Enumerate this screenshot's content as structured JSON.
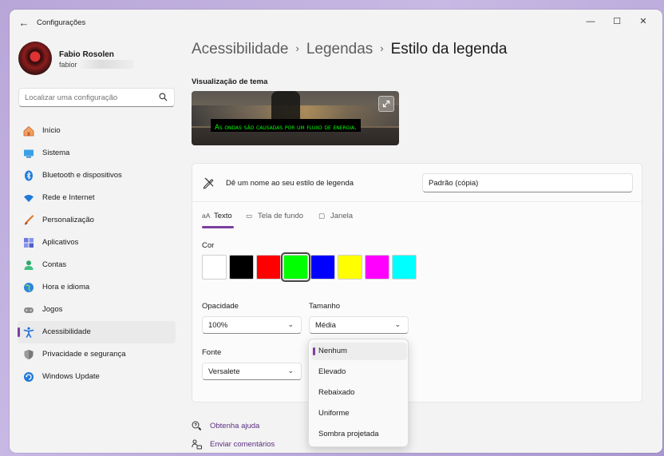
{
  "window": {
    "title": "Configurações",
    "controls": {
      "minimize": "—",
      "maximize": "☐",
      "close": "✕"
    }
  },
  "profile": {
    "name": "Fabio Rosolen",
    "email_visible": "fabior"
  },
  "search": {
    "placeholder": "Localizar uma configuração"
  },
  "sidebar": {
    "items": [
      {
        "label": "Início",
        "icon": "home-icon",
        "color": "#e07a2e"
      },
      {
        "label": "Sistema",
        "icon": "system-icon",
        "color": "#1f8fd8"
      },
      {
        "label": "Bluetooth e dispositivos",
        "icon": "bluetooth-icon",
        "color": "#1f7ad8"
      },
      {
        "label": "Rede e Internet",
        "icon": "wifi-icon",
        "color": "#1f7ad8"
      },
      {
        "label": "Personalização",
        "icon": "brush-icon",
        "color": "#e0702e"
      },
      {
        "label": "Aplicativos",
        "icon": "apps-icon",
        "color": "#5b6bd8"
      },
      {
        "label": "Contas",
        "icon": "account-icon",
        "color": "#2aa86a"
      },
      {
        "label": "Hora e idioma",
        "icon": "globe-clock-icon",
        "color": "#1f7ad8"
      },
      {
        "label": "Jogos",
        "icon": "gamepad-icon",
        "color": "#777777"
      },
      {
        "label": "Acessibilidade",
        "icon": "accessibility-icon",
        "color": "#1f6fd8"
      },
      {
        "label": "Privacidade e segurança",
        "icon": "shield-icon",
        "color": "#6b6b6b"
      },
      {
        "label": "Windows Update",
        "icon": "update-icon",
        "color": "#1f7ad8"
      }
    ],
    "active_index": 9
  },
  "breadcrumb": {
    "items": [
      "Acessibilidade",
      "Legendas"
    ],
    "current": "Estilo da legenda",
    "separator": "›"
  },
  "preview": {
    "title": "Visualização de tema",
    "caption": "As ondas são causadas por um fluxo de energia.",
    "caption_color": "#00ff00"
  },
  "style_name": {
    "label": "Dê um nome ao seu estilo de legenda",
    "value": "Padrão (cópia)"
  },
  "tabs": [
    {
      "label": "Texto",
      "icon": "aA",
      "active": true
    },
    {
      "label": "Tela de fundo",
      "icon": "▭",
      "active": false
    },
    {
      "label": "Janela",
      "icon": "▢",
      "active": false
    }
  ],
  "color": {
    "label": "Cor",
    "swatches": [
      "#ffffff",
      "#000000",
      "#ff0000",
      "#00ff00",
      "#0000ff",
      "#ffff00",
      "#ff00ff",
      "#00ffff"
    ],
    "selected_index": 3
  },
  "opacity": {
    "label": "Opacidade",
    "value": "100%"
  },
  "size": {
    "label": "Tamanho",
    "value": "Média"
  },
  "font": {
    "label": "Fonte",
    "value": "Versalete"
  },
  "effects_dropdown": {
    "options": [
      "Nenhum",
      "Elevado",
      "Rebaixado",
      "Uniforme",
      "Sombra projetada"
    ],
    "selected_index": 0
  },
  "footer": {
    "help": "Obtenha ajuda",
    "feedback": "Enviar comentários"
  },
  "accent_color": "#7b3f9e"
}
